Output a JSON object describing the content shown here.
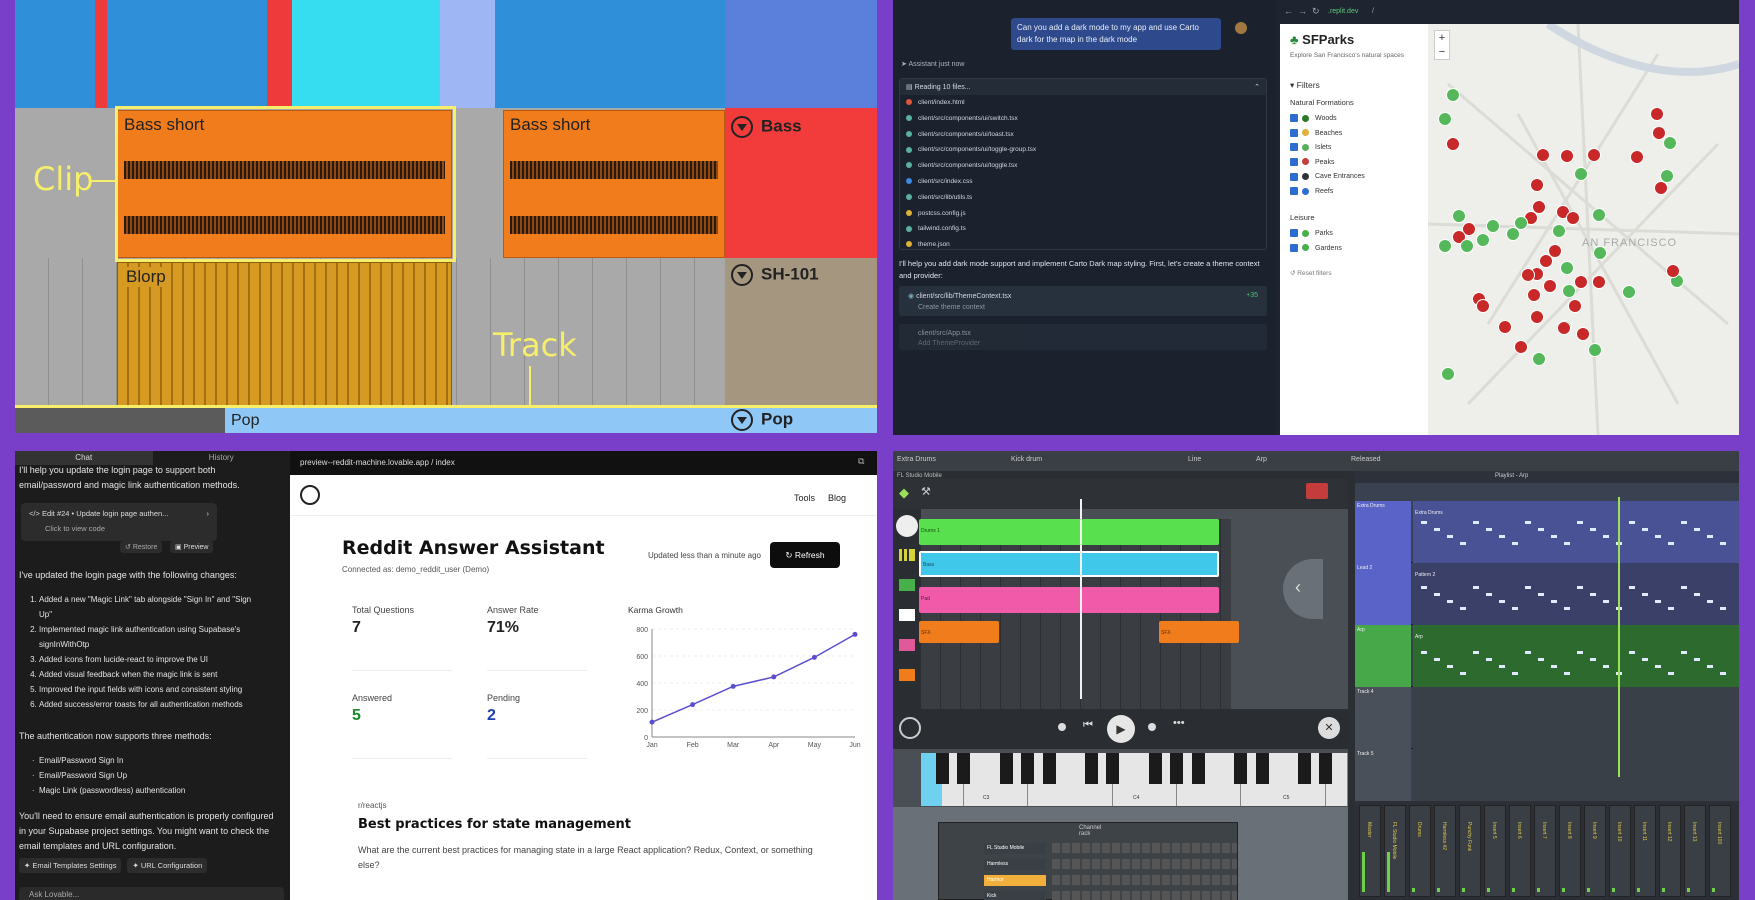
{
  "daw_ableton": {
    "colors": {
      "background": "#3a3a3a",
      "clip": "#f07c1c",
      "midi": "#d69a23",
      "selection": "#f7ee6a",
      "bass_track": "#f23b3b",
      "pop_track": "#8fc8f7"
    },
    "clips": [
      {
        "name": "Bass short"
      },
      {
        "name": "Bass short"
      },
      {
        "name": "Blorp"
      }
    ],
    "annotations": {
      "clip": "Clip",
      "track": "Track"
    },
    "tracks": [
      {
        "name": "Bass"
      },
      {
        "name": "SH-101"
      },
      {
        "name": "Pop"
      }
    ],
    "pop_clip": "Pop"
  },
  "replit": {
    "user_message": "Can you add a dark mode to my app and use Carto dark for the map in the dark mode",
    "assistant_label": "Assistant",
    "assistant_time": "just now",
    "reading": "Reading 10 files...",
    "files": [
      "client/index.html",
      "client/src/components/ui/switch.tsx",
      "client/src/components/ui/toast.tsx",
      "client/src/components/ui/toggle-group.tsx",
      "client/src/components/ui/toggle.tsx",
      "client/src/index.css",
      "client/src/lib/utils.ts",
      "postcss.config.js",
      "tailwind.config.ts",
      "theme.json"
    ],
    "reply": "I'll help you add dark mode support and implement Carto Dark map styling. First, let's create a theme context and provider:",
    "edit1": {
      "file": "client/src/lib/ThemeContext.tsx",
      "desc": "Create theme context",
      "added": "+35",
      "removed": "-0"
    },
    "edit2": {
      "file": "client/src/App.tsx",
      "desc": "Add ThemeProvider"
    },
    "url": ".replit.dev",
    "url_path": "/",
    "app_title": "SFParks",
    "app_subtitle": "Explore San Francisco's natural spaces",
    "filters_label": "Filters",
    "group1": "Natural Formations",
    "group1_items": [
      "Woods",
      "Beaches",
      "Islets",
      "Peaks",
      "Cave Entrances",
      "Reefs"
    ],
    "group2": "Leisure",
    "group2_items": [
      "Parks",
      "Gardens"
    ],
    "reset": "Reset filters",
    "map_label": "AN FRANCISCO",
    "zoom_in": "+",
    "zoom_out": "−"
  },
  "lovable": {
    "tabs": [
      "Chat",
      "History"
    ],
    "intro": "I'll help you update the login page to support both email/password and magic link authentication methods.",
    "edit_card": "Edit #24 • Update login page authen...",
    "view_code": "Click to view code",
    "restore": "Restore",
    "preview": "Preview",
    "updated": "I've updated the login page with the following changes:",
    "changes": [
      "Added a new \"Magic Link\" tab alongside \"Sign In\" and \"Sign Up\"",
      "Implemented magic link authentication using Supabase's signInWithOtp",
      "Added icons from lucide-react to improve the UI",
      "Added visual feedback when the magic link is sent",
      "Improved the input fields with icons and consistent styling",
      "Added success/error toasts for all authentication methods"
    ],
    "supports": "The authentication now supports three methods:",
    "methods": [
      "Email/Password Sign In",
      "Email/Password Sign Up",
      "Magic Link (passwordless) authentication"
    ],
    "note": "You'll need to ensure email authentication is properly configured in your Supabase project settings. You might want to check the email templates and URL configuration.",
    "chips": [
      "Email Templates Settings",
      "URL Configuration"
    ],
    "ask": "Ask Lovable...",
    "address": "preview--reddit-machine.lovable.app / index",
    "nav": [
      "Tools",
      "Blog"
    ],
    "app_title": "Reddit Answer Assistant",
    "connected": "Connected as: demo_reddit_user (Demo)",
    "updated_time": "Updated less than a minute ago",
    "refresh": "Refresh",
    "stats": [
      {
        "label": "Total Questions",
        "value": "7"
      },
      {
        "label": "Answer Rate",
        "value": "71%"
      },
      {
        "label": "Answered",
        "value": "5"
      },
      {
        "label": "Pending",
        "value": "2"
      }
    ],
    "subreddit": "r/reactjs",
    "post_title": "Best practices for state management",
    "post_body": "What are the current best practices for managing state in a large React application? Redux, Context, or something else?"
  },
  "chart_data": {
    "type": "line",
    "title": "Karma Growth",
    "categories": [
      "Jan",
      "Feb",
      "Mar",
      "Apr",
      "May",
      "Jun"
    ],
    "values": [
      110,
      240,
      375,
      445,
      590,
      760
    ],
    "ylim": [
      0,
      800
    ],
    "yticks": [
      0,
      200,
      400,
      600,
      800
    ],
    "color": "#5b4fcf"
  },
  "fl_studio": {
    "channel": "Extra Drums",
    "title_bar": "FL Studio Mobile",
    "kick": "Kick drum",
    "line": "Line",
    "arp": "Arp",
    "released": "Released",
    "playlist": "Playlist - Arp",
    "pattern_blocks": [
      "Drums 1",
      "Bass",
      "Pad",
      "SFX",
      "SFX"
    ],
    "playlist_tracks": [
      {
        "name": "Extra Drums",
        "clip": "Extra Drums"
      },
      {
        "name": "Lead 2",
        "clip": "Pattern 2"
      },
      {
        "name": "Arp",
        "clip": "Arp"
      },
      {
        "name": "Track 4",
        "clip": ""
      },
      {
        "name": "Track 5",
        "clip": ""
      }
    ],
    "channel_rack": "Channel rack",
    "channels": [
      "FL Studio Mobile",
      "Harmless",
      "Harmor",
      "Kick"
    ],
    "octaves": [
      "C3",
      "C4",
      "C5"
    ],
    "mixer_labels": [
      "Master",
      "FL Studio Mobile",
      "Drums",
      "Harmless #2",
      "Punchy Funk",
      "Insert 5",
      "Insert 6",
      "Insert 7",
      "Insert 8",
      "Insert 9",
      "Insert 10",
      "Insert 11",
      "Insert 12",
      "Insert 13",
      "Insert 100"
    ]
  }
}
